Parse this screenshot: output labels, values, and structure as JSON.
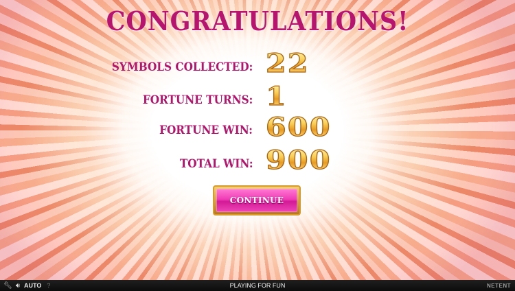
{
  "game": {
    "corner_left": "",
    "corner_right": ""
  },
  "congrats": {
    "title": "CONGRATULATIONS!",
    "rows": [
      {
        "label": "SYMBOLS COLLECTED:",
        "value": "22"
      },
      {
        "label": "FORTUNE TURNS:",
        "value": "1"
      },
      {
        "label": "FORTUNE WIN:",
        "value": "600"
      },
      {
        "label": "TOTAL WIN:",
        "value": "900"
      }
    ],
    "continue_label": "CONTINUE"
  },
  "bottom_bar": {
    "auto_label": "AUTO",
    "help_glyph": "?",
    "status_text": "PLAYING FOR FUN",
    "brand": "NETENT",
    "icons": [
      "settings-icon",
      "sound-icon"
    ]
  },
  "colors": {
    "title": "#b6146e",
    "label": "#b3156c",
    "value_gold": "#f2b23a",
    "button_pink": "#f03cb6",
    "button_border": "#d79a2e",
    "bar_bg": "#121212"
  }
}
